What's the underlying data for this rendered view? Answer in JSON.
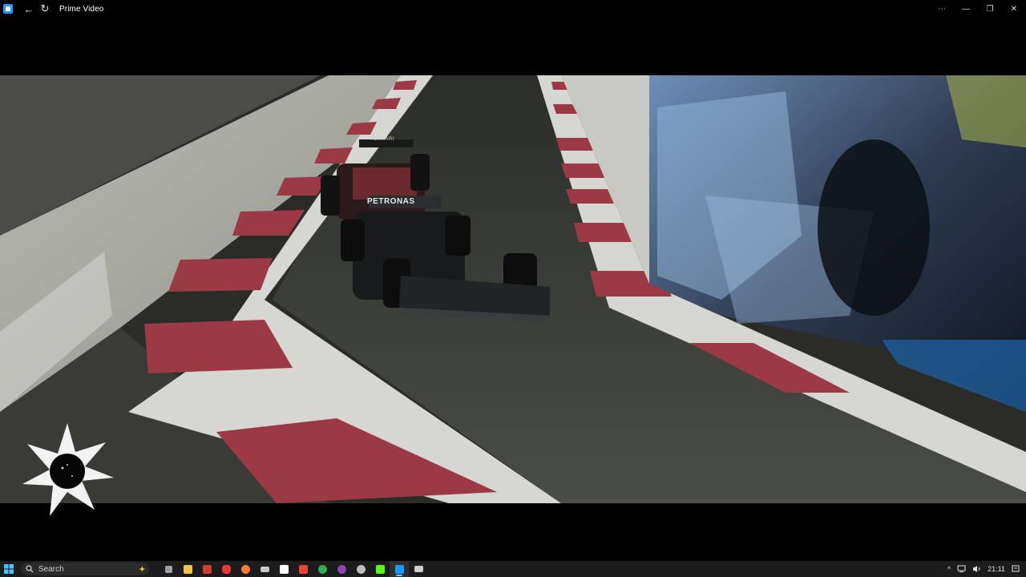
{
  "window": {
    "title": "Prime Video",
    "icons": {
      "app": "prime-video-app-icon",
      "back": "back-arrow-icon",
      "refresh": "refresh-icon",
      "more": "more-options-icon",
      "minimize": "minimize-icon",
      "maximize": "restore-icon",
      "close": "close-icon"
    },
    "glyphs": {
      "back": "←",
      "refresh": "↻",
      "more": "⋯",
      "minimize": "—",
      "maximize": "❐",
      "close": "✕"
    }
  },
  "video": {
    "car_livery_text_1": "PETRONAS",
    "car_livery_text_2": "FERRARI",
    "colors": {
      "track": "#3b3d37",
      "kerb_red": "#9b3a45",
      "kerb_white": "#d9d9d6",
      "wall": "#cfd0c8",
      "sky": "#000000"
    }
  },
  "taskbar": {
    "search_placeholder": "Search",
    "time": "21:11",
    "tray_chevron": "^",
    "pinned": [
      {
        "name": "taskview-icon",
        "color": "#9aa0a6"
      },
      {
        "name": "file-explorer-icon",
        "color": "#f2c14e"
      },
      {
        "name": "app-red-square-icon",
        "color": "#d23a3a"
      },
      {
        "name": "app-youtube-icon",
        "color": "#e53935"
      },
      {
        "name": "firefox-icon",
        "color": "#ff7a2f"
      },
      {
        "name": "app-gamepad-icon",
        "color": "#c9c9c9"
      },
      {
        "name": "app-notion-icon",
        "color": "#ffffff"
      },
      {
        "name": "gmail-icon",
        "color": "#ea4335"
      },
      {
        "name": "app-green-icon",
        "color": "#34a853"
      },
      {
        "name": "app-purple-icon",
        "color": "#8e44ad"
      },
      {
        "name": "app-clock-icon",
        "color": "#bdbdbd"
      },
      {
        "name": "app-k-icon",
        "color": "#53fc18"
      },
      {
        "name": "prime-video-taskbar-icon",
        "color": "#1a98ff"
      },
      {
        "name": "app-terminal-icon",
        "color": "#cfcfcf"
      }
    ]
  }
}
